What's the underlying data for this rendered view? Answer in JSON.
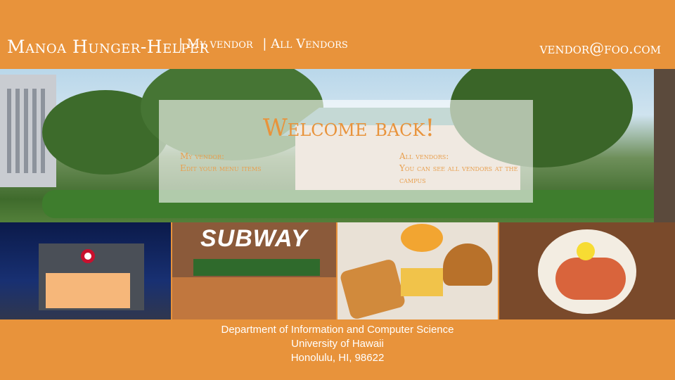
{
  "navbar": {
    "brand": "Manoa Hunger-Helper",
    "links": [
      "| My vendor",
      "| All Vendors"
    ],
    "email": "vendor@foo.com"
  },
  "welcome": {
    "title": "Welcome back!",
    "my_vendor_heading": "My vendor:",
    "my_vendor_text": "Edit your menu items",
    "all_vendors_heading": "All vendors:",
    "all_vendors_text": "You can see all vendors at the campus"
  },
  "photos": {
    "subway_logo_text": "SUBWAY"
  },
  "footer": {
    "lines": [
      "Department of Information and Computer Science",
      "University of Hawaii",
      "Honolulu, HI, 98622"
    ]
  },
  "colors": {
    "brand_orange": "#e8933b",
    "overlay": "rgba(255,255,255,0.6)",
    "text_white": "#ffffff"
  }
}
